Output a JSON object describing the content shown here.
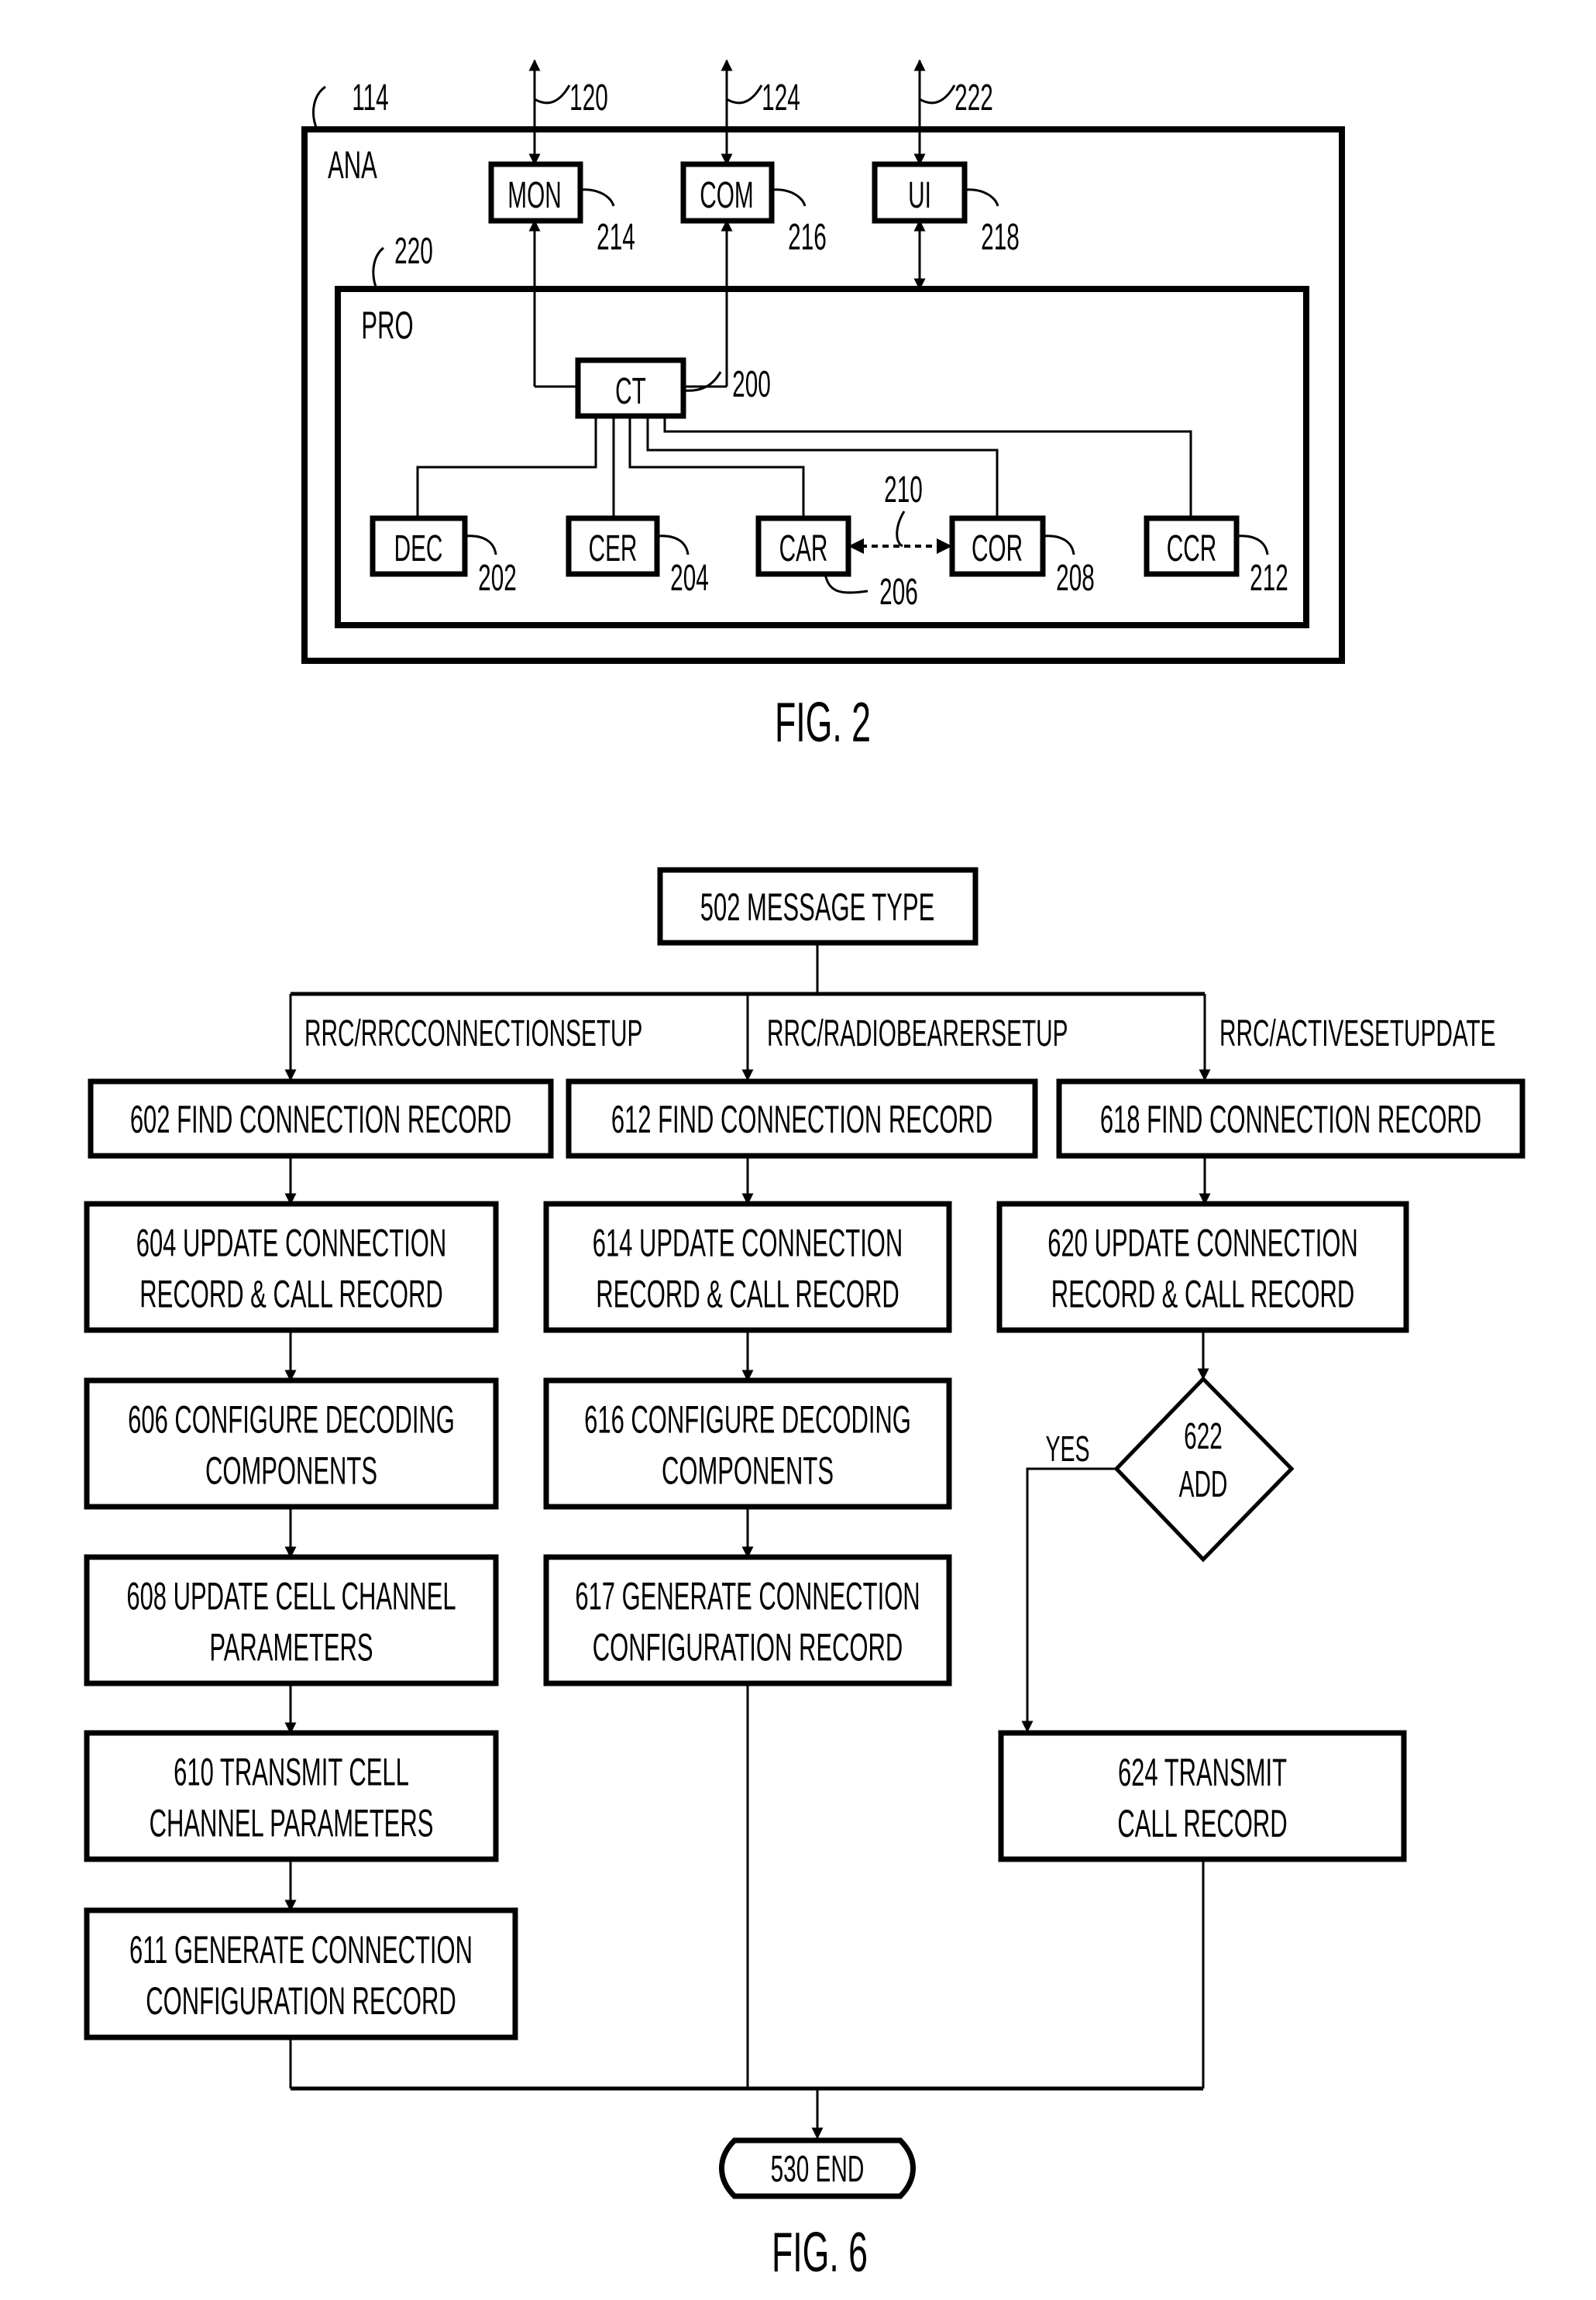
{
  "colors": {
    "ink": "#000000",
    "paper": "#ffffff"
  },
  "fig2": {
    "caption": "FIG. 2",
    "outer_box": {
      "label": "ANA",
      "ref": "114"
    },
    "inner_box": {
      "label": "PRO",
      "ref": "220"
    },
    "external_links": [
      {
        "target": "MON",
        "ref": "120"
      },
      {
        "target": "COM",
        "ref": "124"
      },
      {
        "target": "UI",
        "ref": "222"
      }
    ],
    "top_modules": [
      {
        "id": "mon",
        "label": "MON",
        "ref": "214"
      },
      {
        "id": "com",
        "label": "COM",
        "ref": "216"
      },
      {
        "id": "ui",
        "label": "UI",
        "ref": "218"
      }
    ],
    "controller": {
      "label": "CT",
      "ref": "200"
    },
    "sub_modules": [
      {
        "id": "dec",
        "label": "DEC",
        "ref": "202"
      },
      {
        "id": "cer",
        "label": "CER",
        "ref": "204"
      },
      {
        "id": "car",
        "label": "CAR",
        "ref": "206"
      },
      {
        "id": "cor",
        "label": "COR",
        "ref": "208"
      },
      {
        "id": "ccr",
        "label": "CCR",
        "ref": "212"
      }
    ],
    "car_cor_link": {
      "ref": "210",
      "style": "dotted bidirectional"
    }
  },
  "fig6": {
    "caption": "FIG. 6",
    "start": {
      "label": "502 MESSAGE TYPE"
    },
    "branches": [
      {
        "condition": "RRC/RRCCONNECTIONSETUP",
        "steps": [
          [
            "602 FIND CONNECTION RECORD"
          ],
          [
            "604 UPDATE CONNECTION",
            "RECORD & CALL RECORD"
          ],
          [
            "606 CONFIGURE DECODING",
            "COMPONENTS"
          ],
          [
            "608 UPDATE CELL CHANNEL",
            "PARAMETERS"
          ],
          [
            "610 TRANSMIT CELL",
            "CHANNEL PARAMETERS"
          ],
          [
            "611 GENERATE CONNECTION",
            "CONFIGURATION RECORD"
          ]
        ]
      },
      {
        "condition": "RRC/RADIOBEARERSETUP",
        "steps": [
          [
            "612 FIND CONNECTION RECORD"
          ],
          [
            "614 UPDATE CONNECTION",
            "RECORD & CALL RECORD"
          ],
          [
            "616 CONFIGURE DECODING",
            "COMPONENTS"
          ],
          [
            "617 GENERATE CONNECTION",
            "CONFIGURATION RECORD"
          ]
        ]
      },
      {
        "condition": "RRC/ACTIVESETUPDATE",
        "steps": [
          [
            "618 FIND CONNECTION RECORD"
          ],
          [
            "620 UPDATE CONNECTION",
            "RECORD & CALL RECORD"
          ]
        ],
        "decision": {
          "lines": [
            "622",
            "ADD"
          ],
          "yes_label": "YES"
        },
        "after_decision": [
          "624 TRANSMIT",
          "CALL RECORD"
        ]
      }
    ],
    "end": {
      "label": "530 END"
    }
  }
}
